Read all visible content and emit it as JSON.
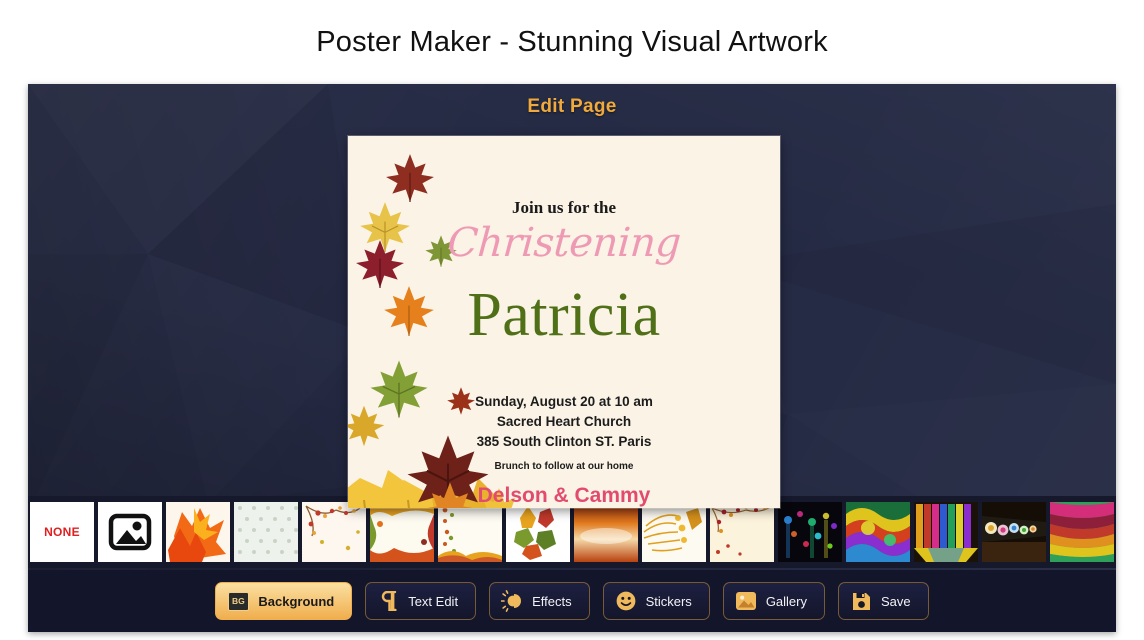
{
  "page": {
    "title": "Poster Maker - Stunning Visual Artwork"
  },
  "app": {
    "header_title": "Edit Page",
    "accent_color": "#f0a93c",
    "background_color": "#252a44"
  },
  "poster": {
    "background_color": "#faf3e6",
    "line_join": "Join us for the",
    "line_event": "Christening",
    "line_name": "Patricia",
    "line_datetime": "Sunday, August 20 at 10 am",
    "line_venue": "Sacred Heart Church",
    "line_address": "385 South Clinton ST. Paris",
    "line_brunch": "Brunch to follow at our home",
    "line_hosts": "Delson & Cammy",
    "event_color": "#ef9ab5",
    "name_color": "#4f7017",
    "hosts_color": "#e34b6e"
  },
  "thumbnails": {
    "items": [
      {
        "name": "none",
        "label": "NONE",
        "type": "none",
        "selected": false
      },
      {
        "name": "picker",
        "label": "",
        "type": "picker",
        "selected": false
      },
      {
        "name": "orange-maple-leaves",
        "label": "",
        "type": "image",
        "selected": false
      },
      {
        "name": "light-dotted-pattern",
        "label": "",
        "type": "image",
        "selected": false
      },
      {
        "name": "cherry-blossom-branch",
        "label": "",
        "type": "image",
        "selected": false
      },
      {
        "name": "autumn-leaf-frame",
        "label": "",
        "type": "image",
        "selected": false
      },
      {
        "name": "star-confetti-frame",
        "label": "",
        "type": "image",
        "selected": true
      },
      {
        "name": "fall-leaf-bouquet",
        "label": "",
        "type": "image",
        "selected": false
      },
      {
        "name": "orange-sunset-texture",
        "label": "",
        "type": "image",
        "selected": false
      },
      {
        "name": "golden-foliage",
        "label": "",
        "type": "image",
        "selected": false
      },
      {
        "name": "cream-berry-branch",
        "label": "",
        "type": "image",
        "selected": false
      },
      {
        "name": "night-bokeh-lights",
        "label": "",
        "type": "image",
        "selected": false
      },
      {
        "name": "rainbow-fractal",
        "label": "",
        "type": "image",
        "selected": false
      },
      {
        "name": "colored-glass-panels",
        "label": "",
        "type": "image",
        "selected": false
      },
      {
        "name": "glowing-lanterns",
        "label": "",
        "type": "image",
        "selected": false
      },
      {
        "name": "rainbow-swirl-waves",
        "label": "",
        "type": "image",
        "selected": false
      }
    ]
  },
  "toolbar": {
    "buttons": [
      {
        "label": "Background",
        "icon": "bg-icon",
        "active": true
      },
      {
        "label": "Text Edit",
        "icon": "pilcrow-icon",
        "active": false
      },
      {
        "label": "Effects",
        "icon": "brightness-icon",
        "active": false
      },
      {
        "label": "Stickers",
        "icon": "smiley-icon",
        "active": false
      },
      {
        "label": "Gallery",
        "icon": "image-icon",
        "active": false
      },
      {
        "label": "Save",
        "icon": "floppy-disk-icon",
        "active": false
      }
    ]
  }
}
